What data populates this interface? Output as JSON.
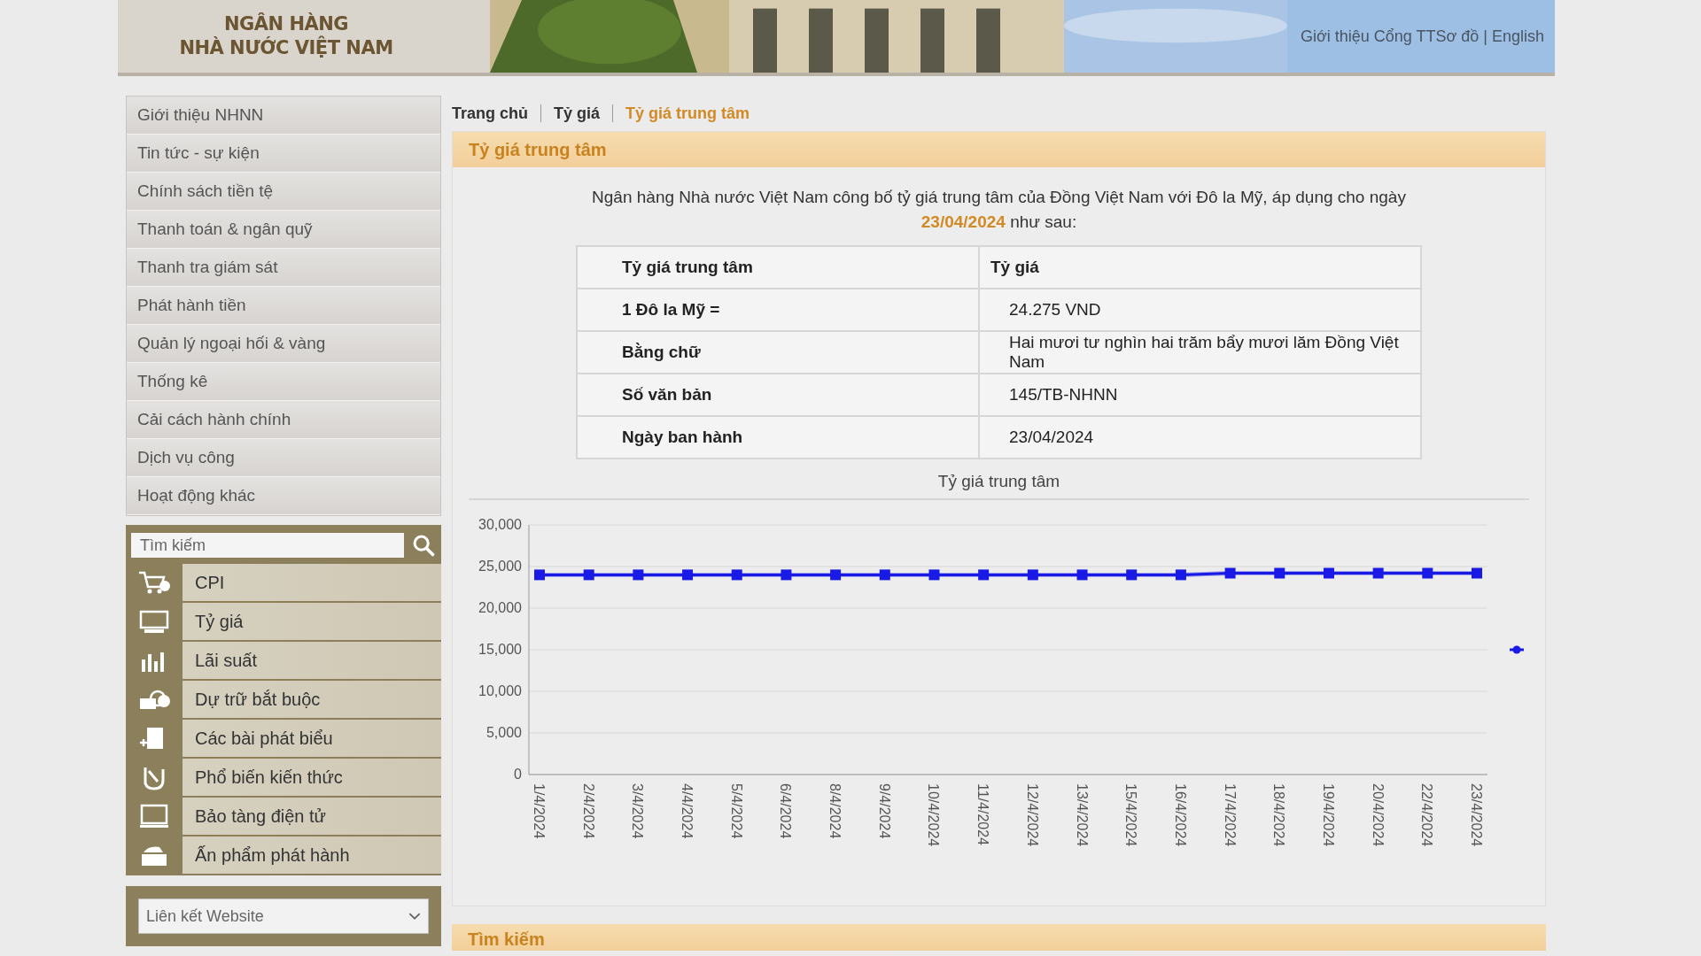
{
  "header": {
    "logo_lines": [
      "NGÂN HÀNG",
      "NHÀ NƯỚC VIỆT NAM"
    ],
    "links": "Giới thiệu Cổng TTSơ đồ | English"
  },
  "sidebar": {
    "menu": [
      {
        "label": "Giới thiệu NHNN"
      },
      {
        "label": "Tin tức - sự kiện"
      },
      {
        "label": "Chính sách tiền tệ"
      },
      {
        "label": "Thanh toán & ngân quỹ"
      },
      {
        "label": "Thanh tra giám sát"
      },
      {
        "label": "Phát hành tiền"
      },
      {
        "label": "Quản lý ngoại hối & vàng"
      },
      {
        "label": "Thống kê"
      },
      {
        "label": "Cải cách hành chính"
      },
      {
        "label": "Dịch vụ công"
      },
      {
        "label": "Hoạt động khác"
      }
    ],
    "search": {
      "placeholder": "Tìm kiếm"
    },
    "quick_links": [
      {
        "label": "CPI"
      },
      {
        "label": "Tỷ giá"
      },
      {
        "label": "Lãi suất"
      },
      {
        "label": "Dự trữ bắt buộc"
      },
      {
        "label": "Các bài phát biểu"
      },
      {
        "label": "Phổ biến kiến thức"
      },
      {
        "label": "Bảo tàng điện tử"
      },
      {
        "label": "Ấn phẩm phát hành"
      }
    ],
    "website_select": {
      "value": "Liên kết Website"
    }
  },
  "breadcrumb": [
    {
      "label": "Trang chủ",
      "selected": false
    },
    {
      "label": "Tỷ giá",
      "selected": false
    },
    {
      "label": "Tỷ giá trung tâm",
      "selected": true
    }
  ],
  "section": {
    "title": "Tỷ giá trung tâm",
    "intro": "Ngân hàng Nhà nước Việt Nam công bố tỷ giá trung tâm của Đồng Việt Nam với Đô la Mỹ, áp dụng cho ngày **23/04/2024** như sau:",
    "table": {
      "columns": [
        "Tỷ giá trung tâm",
        "Tỷ giá"
      ],
      "rows": [
        [
          "1 Đô la Mỹ =",
          "24.275 VND"
        ],
        [
          "Bằng chữ",
          "Hai mươi tư nghìn hai trăm bẩy mươi lăm Đồng Việt Nam"
        ],
        [
          "Số văn bản",
          "145/TB-NHNN"
        ],
        [
          "Ngày ban hành",
          "23/04/2024"
        ]
      ]
    },
    "chart_data": {
      "type": "line",
      "title": "Tỷ giá trung tâm",
      "categories": [
        "1/4/2024",
        "2/4/2024",
        "3/4/2024",
        "4/4/2024",
        "5/4/2024",
        "6/4/2024",
        "8/4/2024",
        "9/4/2024",
        "10/4/2024",
        "11/4/2024",
        "12/4/2024",
        "13/4/2024",
        "15/4/2024",
        "16/4/2024",
        "17/4/2024",
        "18/4/2024",
        "19/4/2024",
        "20/4/2024",
        "22/4/2024",
        "23/4/2024"
      ],
      "ylim": [
        0,
        30000
      ],
      "yticks": [
        {
          "value": 0,
          "label": "0"
        },
        {
          "value": 5000,
          "label": "5,000"
        },
        {
          "value": 10000,
          "label": "10,000"
        },
        {
          "value": 15000,
          "label": "15,000"
        },
        {
          "value": 20000,
          "label": "20,000"
        },
        {
          "value": 25000,
          "label": "25,000"
        },
        {
          "value": 30000,
          "label": "30,000"
        }
      ],
      "grid": true,
      "series": [
        {
          "color": "#1a1ae6",
          "marker": "square",
          "values": [
            24000,
            24000,
            24000,
            24000,
            24000,
            24000,
            24000,
            24000,
            24000,
            24000,
            24000,
            24000,
            24000,
            24000,
            24200,
            24200,
            24200,
            24200,
            24200,
            24200
          ]
        }
      ]
    }
  },
  "search_section": {
    "title": "Tìm kiếm"
  }
}
